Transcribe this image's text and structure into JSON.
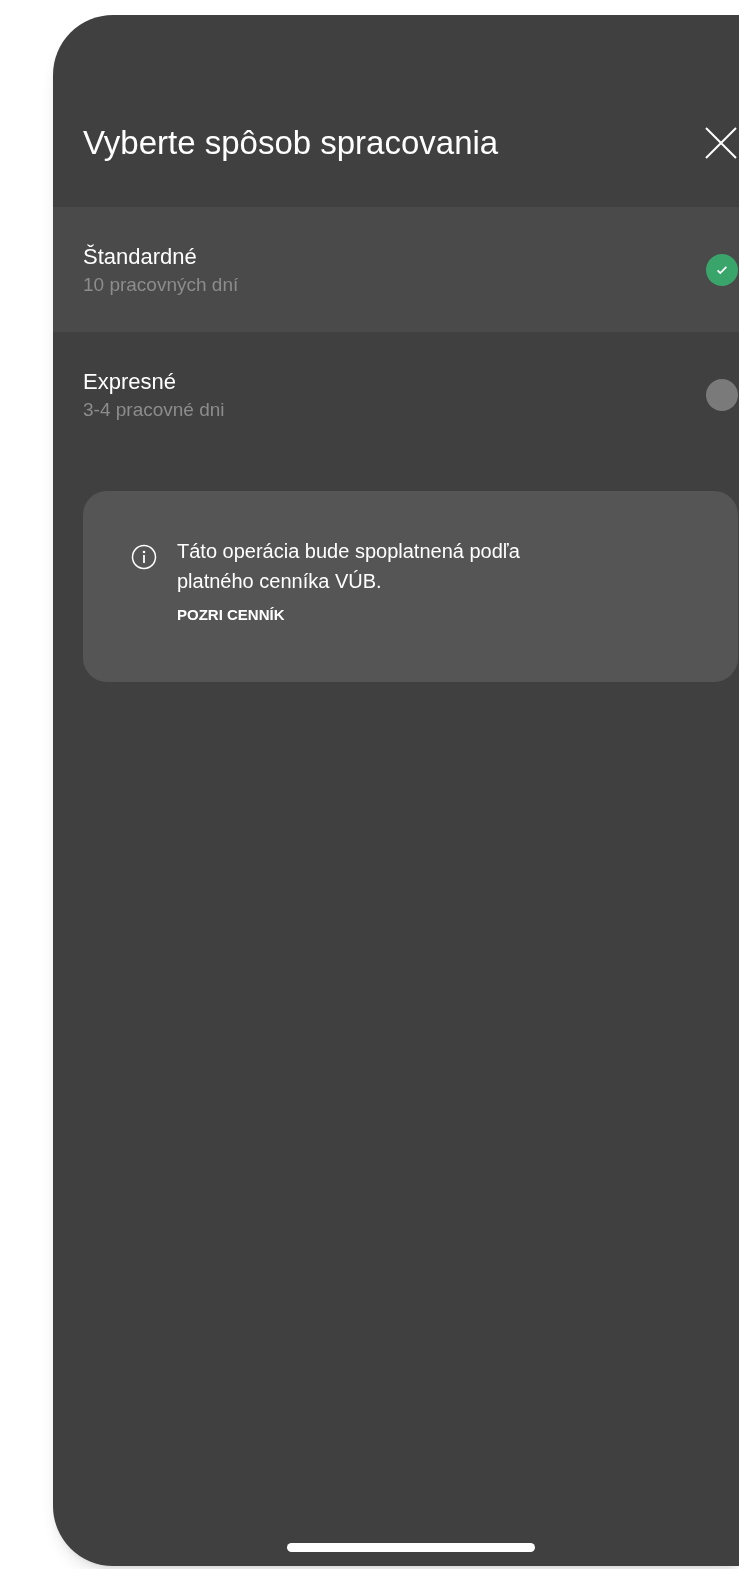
{
  "header": {
    "title": "Vyberte spôsob spracovania"
  },
  "options": [
    {
      "label": "Štandardné",
      "detail": "10 pracovných dní",
      "selected": true
    },
    {
      "label": "Expresné",
      "detail": "3-4 pracovné dni",
      "selected": false
    }
  ],
  "notice": {
    "text": "Táto operácia bude spoplatnená podľa platného cenníka VÚB.",
    "link": "POZRI CENNÍK"
  }
}
